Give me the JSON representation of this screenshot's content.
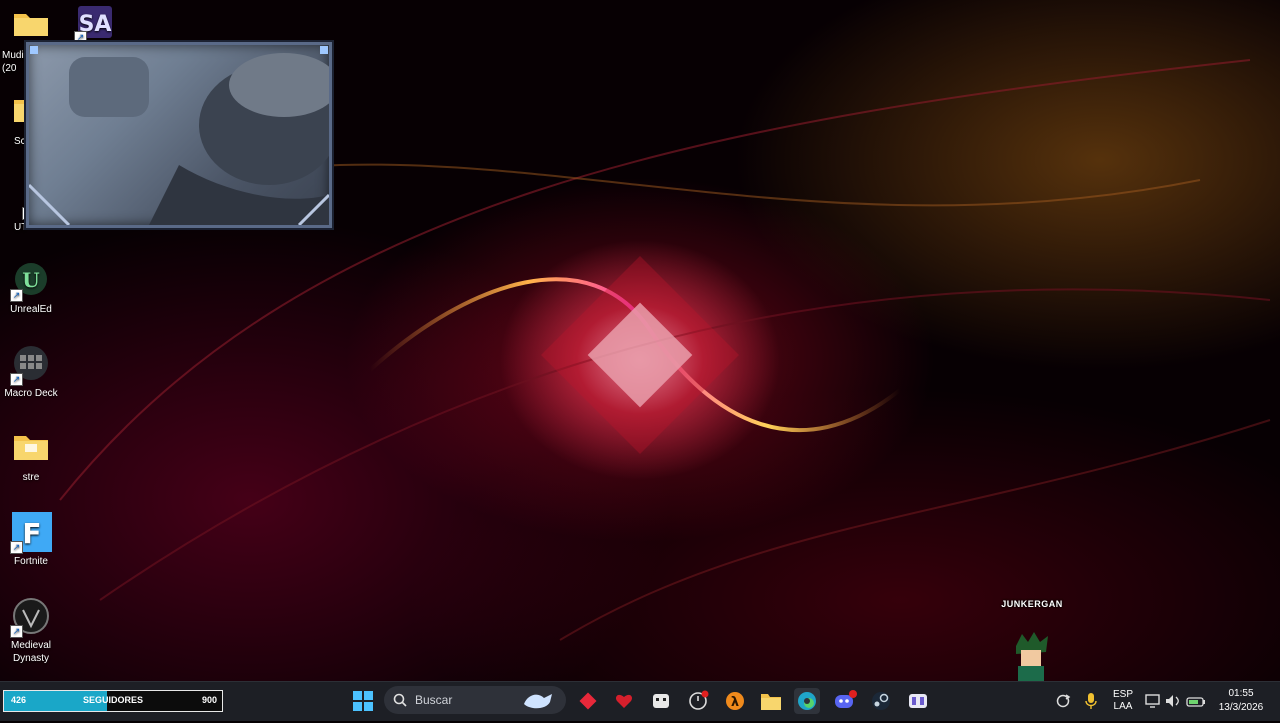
{
  "desktop_icons": [
    {
      "name": "folder-icon",
      "label": "Mudi\n(20"
    },
    {
      "name": "sa-icon",
      "label": ""
    },
    {
      "name": "folder-icon",
      "label": "Sc"
    },
    {
      "name": "app-icon",
      "label": "UT"
    },
    {
      "name": "unreal-icon",
      "label": "UnrealEd"
    },
    {
      "name": "macro-deck-icon",
      "label": "Macro Deck"
    },
    {
      "name": "folder-icon",
      "label": "stre"
    },
    {
      "name": "fortnite-icon",
      "label": "Fortnite"
    },
    {
      "name": "medieval-dynasty-icon",
      "label": "Medieval\nDynasty"
    }
  ],
  "overlay": {
    "character_name": "JUNKERGAN",
    "followers": {
      "current": "426",
      "label": "SEGUIDORES",
      "goal": "900",
      "fraction": 0.473
    }
  },
  "taskbar": {
    "search_placeholder": "Buscar",
    "pinned_icons": [
      "windows-start-icon",
      "search-icon",
      "duck-icon",
      "diamond-icon",
      "heart-icon",
      "robot-icon",
      "clock-app-icon",
      "half-life-icon",
      "file-explorer-icon",
      "edge-icon",
      "discord-icon",
      "steam-icon",
      "controller-icon"
    ],
    "tray": {
      "lang_top": "ESP",
      "lang_bottom": "LAA",
      "time": "01:55",
      "date": "13/3/2026"
    }
  },
  "colors": {
    "taskbar_bg": "#1d1f25",
    "follow_fill": "#1aa7c8"
  }
}
